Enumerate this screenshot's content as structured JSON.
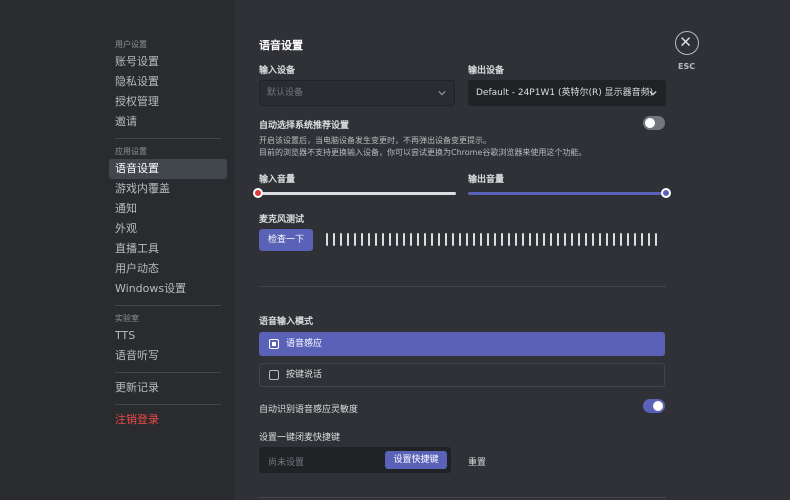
{
  "sidebar": {
    "groups": [
      {
        "title": "用户设置",
        "items": [
          "账号设置",
          "隐私设置",
          "授权管理",
          "邀请"
        ]
      },
      {
        "title": "应用设置",
        "items": [
          "语音设置",
          "游戏内覆盖",
          "通知",
          "外观",
          "直播工具",
          "用户动态",
          "Windows设置"
        ]
      },
      {
        "title": "实验室",
        "items": [
          "TTS",
          "语音听写"
        ]
      }
    ],
    "changelog": "更新记录",
    "logout": "注销登录"
  },
  "main": {
    "title": "语音设置",
    "input_device_label": "输入设备",
    "input_device_value": "默认设备",
    "output_device_label": "输出设备",
    "output_device_value": "Default - 24P1W1 (英特尔(R) 显示器音频)",
    "auto_select_label": "自动选择系统推荐设置",
    "auto_select_desc1": "开启该设置后，当电脑设备发生变更时，不再弹出设备变更提示。",
    "auto_select_desc2": "目前的浏览器不支持更换输入设备，你可以尝试更换为Chrome谷歌浏览器来使用这个功能。",
    "input_volume_label": "输入音量",
    "input_volume_value": 0,
    "output_volume_label": "输出音量",
    "output_volume_value": 100,
    "mic_test_label": "麦克风测试",
    "mic_test_button": "检查一下",
    "voice_mode_label": "语音输入模式",
    "voice_mode_options": [
      "语音感应",
      "按键说话"
    ],
    "voice_mode_selected": "语音感应",
    "auto_sensitivity_label": "自动识别语音感应灵敏度",
    "auto_sensitivity_enabled": true,
    "auto_select_enabled": false,
    "shortcut_label": "设置一键闭麦快捷键",
    "shortcut_placeholder": "尚未设置",
    "shortcut_button": "设置快捷键",
    "reset_label": "重置"
  },
  "close": {
    "esc_label": "ESC"
  },
  "colors": {
    "accent": "#5a62b8",
    "danger": "#f04747",
    "slider_input": "#e03b3b"
  },
  "icons": {
    "close": "close-icon",
    "chevron": "chevron-down-icon"
  }
}
